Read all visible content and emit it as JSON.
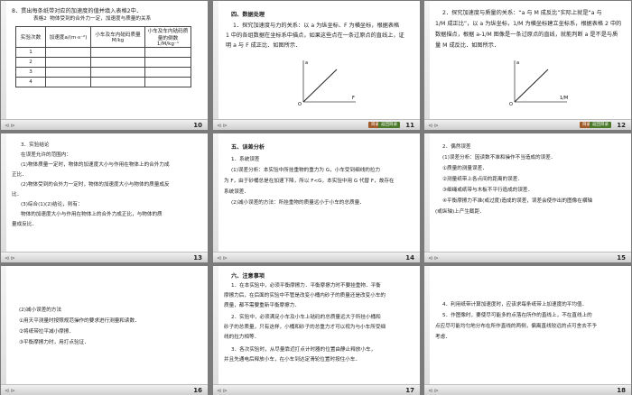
{
  "slides": [
    {
      "num": "10",
      "heading": "8．贯出每条纸带对应的加速度的值并填入表格2中．",
      "caption": "表格2  物体受到的合外力一定，加速度与质量的关系",
      "table": {
        "headers": [
          "实验次数",
          "加速度a/(m·s⁻²)",
          "小车及车内砝码质量M/kg",
          "小车及车内砝码质量的倒数1/M/kg⁻¹"
        ],
        "rows": [
          "1",
          "2",
          "3",
          "4"
        ]
      }
    },
    {
      "num": "11",
      "title": "四、数据处理",
      "lines": [
        "1．探究加速度与力的关系：以 a 为纵坐标、F 为横坐标，根据表格",
        "1 中的各组数据在坐标系中描点，如果这些点在一条过原点的直线上，证",
        "明 a 与 F 成正比．如图所示．"
      ],
      "axis_y": "a",
      "axis_x": "F",
      "origin": "O"
    },
    {
      "num": "12",
      "lines": [
        "2．探究加速度与质量的关系：“a 与 M 成反比”实际上就是“a 与",
        "1/M 成正比”，以 a 为纵坐标，1/M 为横坐标建立坐标系，根据表格 2 中的",
        "数据描点，根据 a-1/M 图像是一条过原点的直线，就能判断 a 是不是与质",
        "量 M 成反比．如图所示．"
      ],
      "axis_y": "a",
      "axis_x": "1/M",
      "origin": "O"
    },
    {
      "num": "13",
      "lines": [
        "3．实验结论",
        "在误差允许的范围内：",
        "(1)物体质量一定时，物体的加速度大小与作用在物体上的合外力成",
        "正比．",
        "(2)物体受到的合外力一定时，物体的加速度大小与物体的质量成反",
        "比．",
        "(3)综合(1)(2)结论，则有：",
        "物体的加速度大小与作用在物体上的合外力成正比，与物体的质",
        "量成反比．"
      ]
    },
    {
      "num": "14",
      "title": "五、误差分析",
      "lines": [
        "1．系统误差",
        "(1)误差分析：本实验中所挂重物的重力为 G，小车受到细线的拉力",
        "为 F，由于砂桶总是在加速下降，所以 F<G，本实验中用 G 代替 F，故存在",
        "系统误差．",
        "(2)减小误差的方法：所挂重物的质量远小于小车的总质量．"
      ]
    },
    {
      "num": "15",
      "lines": [
        "2．偶然误差",
        "(1)误差分析：因读数不准和操作不当造成的误差．",
        "①质量的测量误差．",
        "②测量纸带上各点间的距离的误差．",
        "③细绳或纸带与木板不平行造成的误差．",
        "④平衡摩擦力不准(或过度)造成的误差，误差会使作出的图像在横轴",
        "(或纵轴)上产生截距．"
      ]
    },
    {
      "num": "16",
      "lines": [
        "(2)减小误差的方法",
        "①用天平测量时按照规范操作的要求进行测量和读数．",
        "②将纸带拉平减小摩擦．",
        "③平衡摩擦力时，用打点验证．"
      ]
    },
    {
      "num": "17",
      "title": "六、注意事项",
      "lines": [
        "1．在本实验中，必须平衡摩擦力．平衡摩擦力时不要挂重物．平衡",
        "摩擦力后，在后面的实验中不管是改变小桶内砂子的质量还是改变小车的",
        "质量，都不需要重新平衡摩擦力．",
        "2．实验中，必须满足小车及小车上砝码的总质量远大于所挂小桶和",
        "砂子的总质量，只有这样，小桶和砂子的总重力才可以视为与小车所受细",
        "线的拉力相等．",
        "3．各次实验时，从尽量靠近打点计时器的位置由静止释放小车，",
        "并且先通电后释放小车，在小车到达定滑轮位置时按住小车．"
      ]
    },
    {
      "num": "18",
      "lines": [
        "4．利用纸带计算加速度时，应该求每条纸带上加速度的平均值．",
        "5．作图像时，要使尽可能多的点落在所作的直线上，不在直线上的",
        "点应尽可能均匀地分布在所作直线的两侧，偏离直线较远的点可舍去不予",
        "考虑．"
      ]
    }
  ],
  "footer": {
    "badge1": "目录",
    "badge2": "返回目录",
    "ctrl": "⊲ ⊳"
  }
}
